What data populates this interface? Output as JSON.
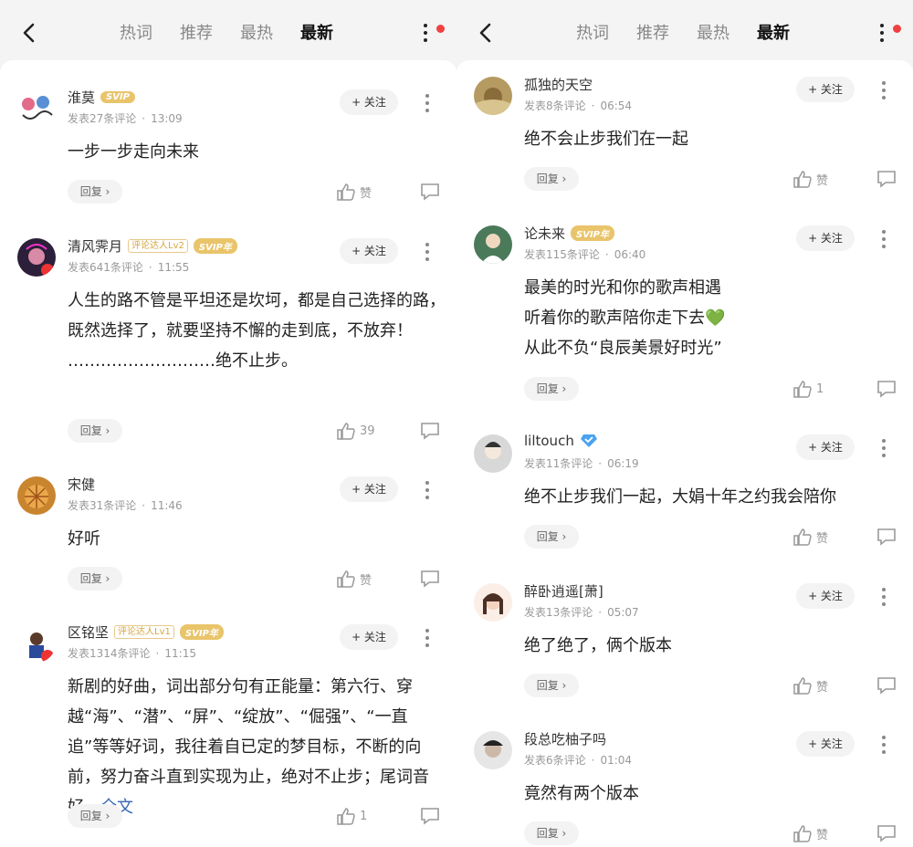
{
  "left": {
    "tabs": [
      "热词",
      "推荐",
      "最热",
      "最新"
    ],
    "active_tab": "最新",
    "comments": [
      {
        "name": "淮莫",
        "svip": "SVIP",
        "lv": "",
        "meta_count": "发表27条评论",
        "time": "13:09",
        "follow": "+ 关注",
        "text": "一步一步走向未来",
        "reply": "回复 ›",
        "likes": "赞"
      },
      {
        "name": "清风霁月",
        "svip": "SVIP年",
        "lv": "评论达人Lv2",
        "meta_count": "发表641条评论",
        "time": "11:55",
        "follow": "+ 关注",
        "text": "人生的路不管是平坦还是坎坷，都是自己选择的路，既然选择了，就要坚持不懈的走到底，不放弃！\n………………………绝不止步。",
        "reply": "回复 ›",
        "likes": "39"
      },
      {
        "name": "宋健",
        "svip": "",
        "lv": "",
        "meta_count": "发表31条评论",
        "time": "11:46",
        "follow": "+ 关注",
        "text": "好听",
        "reply": "回复 ›",
        "likes": "赞"
      },
      {
        "name": "区铭坚",
        "svip": "SVIP年",
        "lv": "评论达人Lv1",
        "meta_count": "发表1314条评论",
        "time": "11:15",
        "follow": "+ 关注",
        "text": "新剧的好曲，词出部分句有正能量：第六行、穿越“海”、“潜”、“屏”、“绽放”、“倔强”、“一直追”等等好词，我往着自已定的梦目标，不断的向前，努力奋斗直到实现为止，绝对不止步；尾词音好…",
        "link": "全文",
        "reply": "回复 ›",
        "likes": "1"
      }
    ]
  },
  "right": {
    "tabs": [
      "热词",
      "推荐",
      "最热",
      "最新"
    ],
    "active_tab": "最新",
    "comments": [
      {
        "name": "孤独的天空",
        "svip": "",
        "lv": "",
        "meta_count": "发表8条评论",
        "time": "06:54",
        "follow": "+ 关注",
        "text": "绝不会止步我们在一起",
        "reply": "回复 ›",
        "likes": "赞"
      },
      {
        "name": "论未来",
        "svip": "SVIP年",
        "lv": "",
        "meta_count": "发表115条评论",
        "time": "06:40",
        "follow": "+ 关注",
        "text": "最美的时光和你的歌声相遇\n听着你的歌声陪你走下去💚\n从此不负“良辰美景好时光”",
        "reply": "回复 ›",
        "likes": "1"
      },
      {
        "name": "liltouch",
        "svip": "",
        "lv": "",
        "verified": true,
        "meta_count": "发表11条评论",
        "time": "06:19",
        "follow": "+ 关注",
        "text": "绝不止步我们一起，大娟十年之约我会陪你",
        "reply": "回复 ›",
        "likes": "赞"
      },
      {
        "name": "醉卧逍遥[萧]",
        "svip": "",
        "lv": "",
        "meta_count": "发表13条评论",
        "time": "05:07",
        "follow": "+ 关注",
        "text": "绝了绝了，俩个版本",
        "reply": "回复 ›",
        "likes": "赞"
      },
      {
        "name": "段总吃柚子吗",
        "svip": "",
        "lv": "",
        "meta_count": "发表6条评论",
        "time": "01:04",
        "follow": "+ 关注",
        "text": "竟然有两个版本",
        "reply": "回复 ›",
        "likes": "赞"
      }
    ]
  },
  "colors": {
    "svip": "#e9c46a",
    "link": "#3467b8",
    "red_dot": "#f04040",
    "heart": "#7cc36b"
  }
}
